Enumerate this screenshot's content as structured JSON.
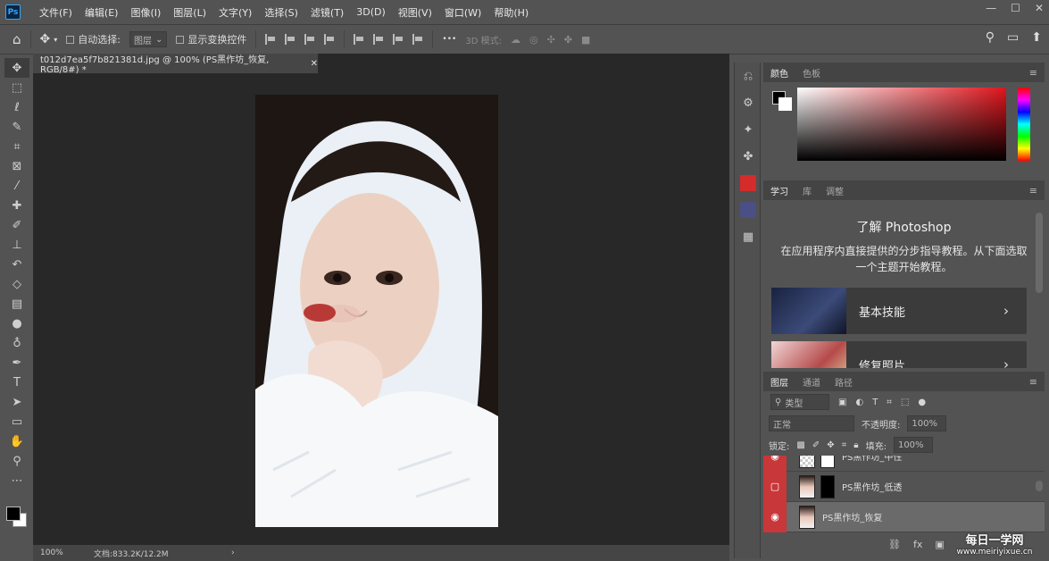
{
  "menu": [
    "文件(F)",
    "编辑(E)",
    "图像(I)",
    "图层(L)",
    "文字(Y)",
    "选择(S)",
    "滤镜(T)",
    "3D(D)",
    "视图(V)",
    "窗口(W)",
    "帮助(H)"
  ],
  "logo": "Ps",
  "window_controls": [
    "—",
    "☐",
    "✕"
  ],
  "options": {
    "auto_select_label": "自动选择:",
    "auto_select_value": "图层",
    "show_transform_label": "显示变换控件",
    "mode3d_label": "3D 模式:",
    "more": "•••"
  },
  "document": {
    "tab_title": "t012d7ea5f7b821381d.jpg @ 100% (PS黑作坊_恢复, RGB/8#) *",
    "zoom": "100%",
    "doc_info": "文档:833.2K/12.2M"
  },
  "color_panel": {
    "tabs": [
      "颜色",
      "色板"
    ],
    "active": "颜色"
  },
  "learn_panel": {
    "tabs": [
      "学习",
      "库",
      "调整"
    ],
    "active": "学习",
    "title": "了解 Photoshop",
    "desc": "在应用程序内直接提供的分步指导教程。从下面选取一个主题开始教程。",
    "cards": [
      "基本技能",
      "修复照片"
    ]
  },
  "layers_panel": {
    "tabs": [
      "图层",
      "通道",
      "路径"
    ],
    "active": "图层",
    "filter": "类型",
    "blend_mode": "正常",
    "opacity_label": "不透明度:",
    "opacity": "100%",
    "lock_label": "锁定:",
    "fill_label": "填充:",
    "fill": "100%",
    "layers": [
      {
        "name": "PS黑作坊_中性",
        "visible": true
      },
      {
        "name": "PS黑作坊_低透",
        "visible": false
      },
      {
        "name": "PS黑作坊_恢复",
        "visible": true
      }
    ],
    "footer": [
      "⛓",
      "fx"
    ]
  },
  "watermark": {
    "line1": "每日一学网",
    "line2": "www.meiriyixue.cn"
  },
  "colors": {
    "accent": "#c8373a",
    "panel": "#535353",
    "canvas_bg": "#282828"
  }
}
